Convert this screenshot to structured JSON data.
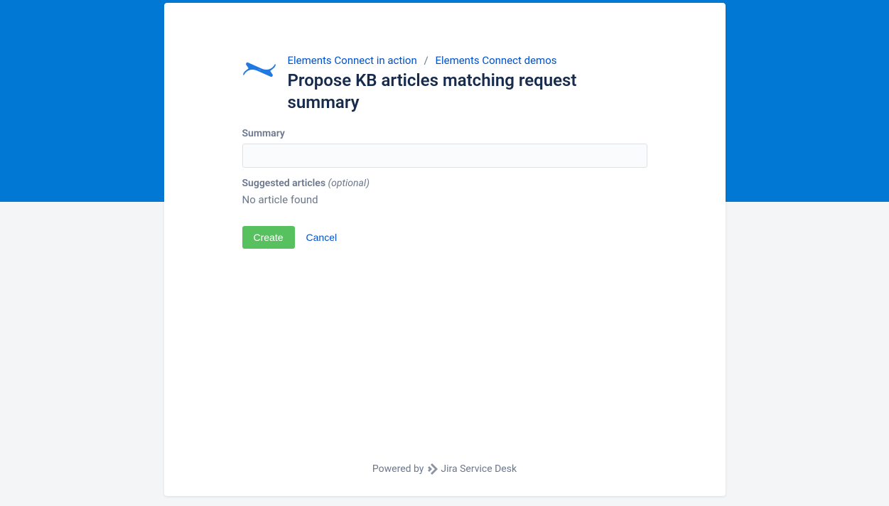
{
  "breadcrumb": {
    "parent": "Elements Connect in action",
    "current": "Elements Connect demos"
  },
  "page": {
    "title": "Propose KB articles matching request summary"
  },
  "form": {
    "summary_label": "Summary",
    "summary_value": "",
    "suggested_label": "Suggested articles",
    "suggested_optional": "(optional)",
    "suggested_empty": "No article found",
    "create_label": "Create",
    "cancel_label": "Cancel"
  },
  "footer": {
    "powered_by": "Powered by",
    "product": "Jira Service Desk"
  }
}
